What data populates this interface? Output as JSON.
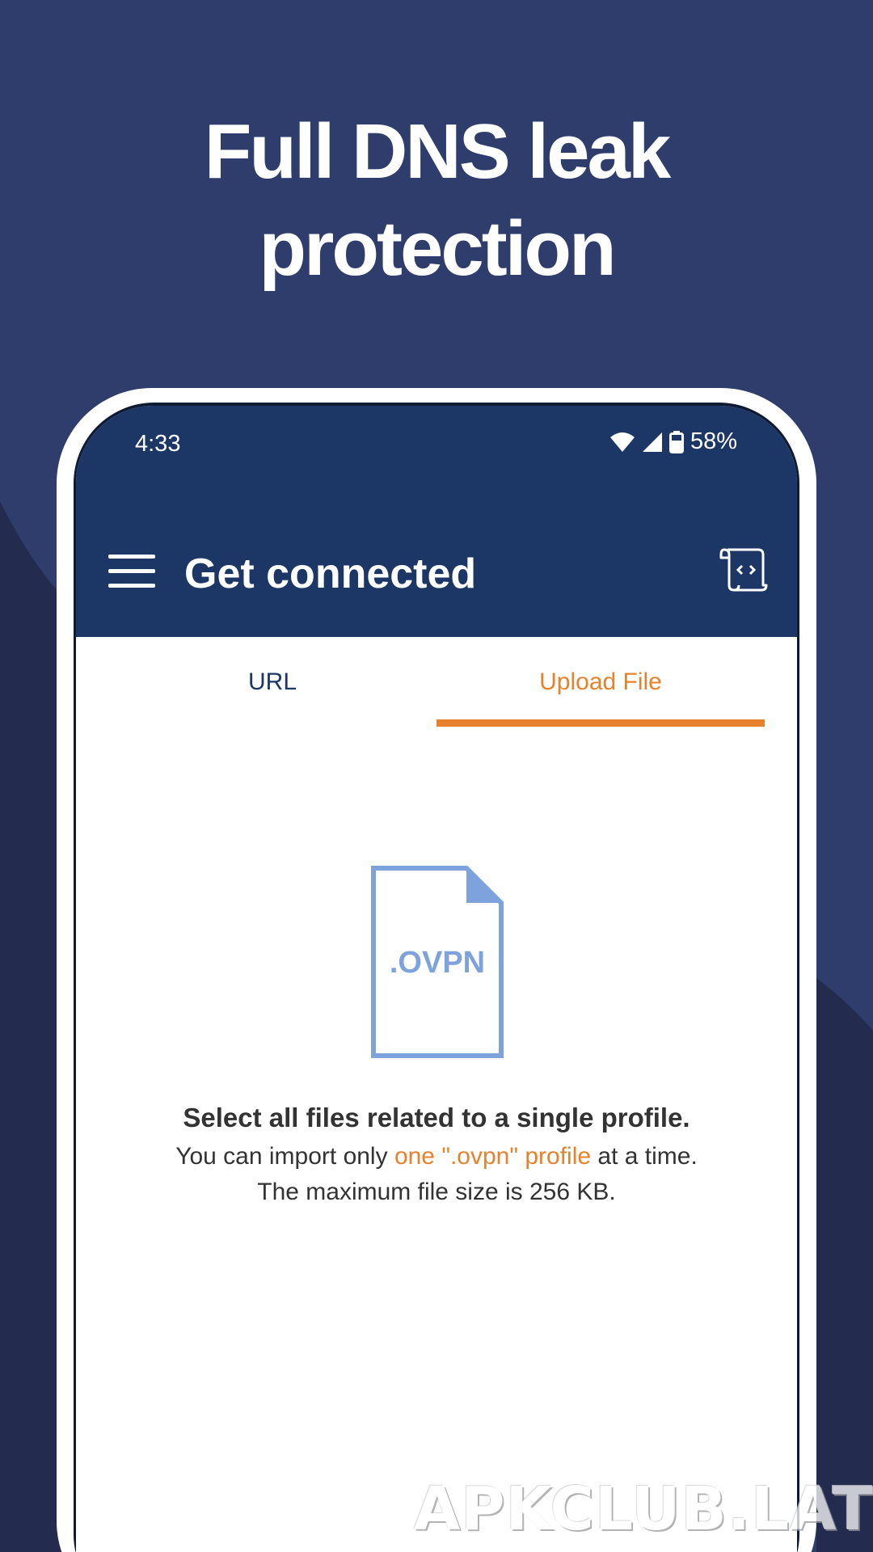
{
  "headline": {
    "line1": "Full DNS leak",
    "line2": "protection"
  },
  "status_bar": {
    "time": "4:33",
    "battery": "58%",
    "icons": [
      "wifi-icon",
      "cellular-signal-icon",
      "battery-icon"
    ]
  },
  "toolbar": {
    "title": "Get connected",
    "menu_icon": "menu-icon",
    "log_icon": "log-scroll-icon"
  },
  "tabs": [
    {
      "label": "URL",
      "selected": false
    },
    {
      "label": "Upload File",
      "selected": true
    }
  ],
  "upload": {
    "file_icon_label": ".OVPN",
    "heading": "Select all files related to a single profile.",
    "line1_prefix": "You can import only ",
    "line1_link": "one \".ovpn\" profile",
    "line1_suffix": " at a time.",
    "line2": "The maximum file size is 256 KB."
  },
  "watermark": "APKCLUB.LAT",
  "colors": {
    "background": "#2e3d6b",
    "appbar": "#1c3665",
    "accent": "#e8812c",
    "file_icon": "#7ea2dc",
    "text": "#333333"
  }
}
